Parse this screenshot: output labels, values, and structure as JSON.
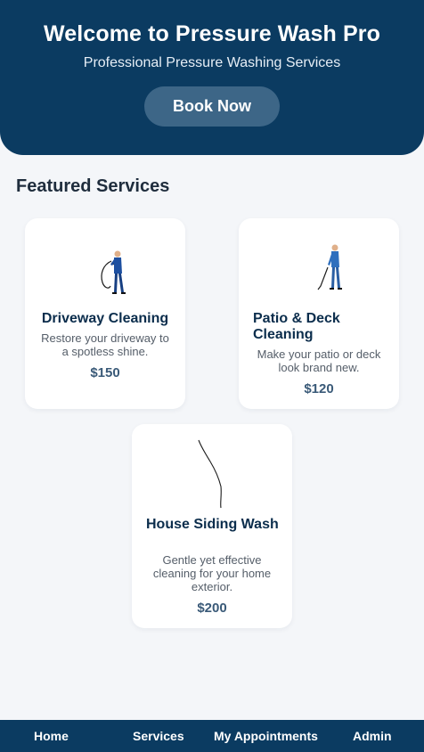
{
  "hero": {
    "title": "Welcome to Pressure Wash Pro",
    "subtitle": "Professional Pressure Washing Services",
    "button_label": "Book Now"
  },
  "featured": {
    "heading": "Featured Services",
    "services": [
      {
        "title": "Driveway Cleaning",
        "description": "Restore your driveway to a spotless shine.",
        "price": "$150",
        "image": "pressure-washer-worker-illustration"
      },
      {
        "title": "Patio & Deck Cleaning",
        "description": "Make your patio or deck look brand new.",
        "price": "$120",
        "image": "pressure-washer-worker-illustration"
      },
      {
        "title": "House Siding Wash",
        "description": "Gentle yet effective cleaning for your home exterior.",
        "price": "$200",
        "image": "hose-line-illustration"
      }
    ]
  },
  "nav": {
    "items": [
      "Home",
      "Services",
      "My Appointments",
      "Admin"
    ]
  },
  "colors": {
    "primary": "#0b3b61",
    "button": "#3d6687",
    "background": "#f4f6f9",
    "price": "#3a5a78"
  }
}
